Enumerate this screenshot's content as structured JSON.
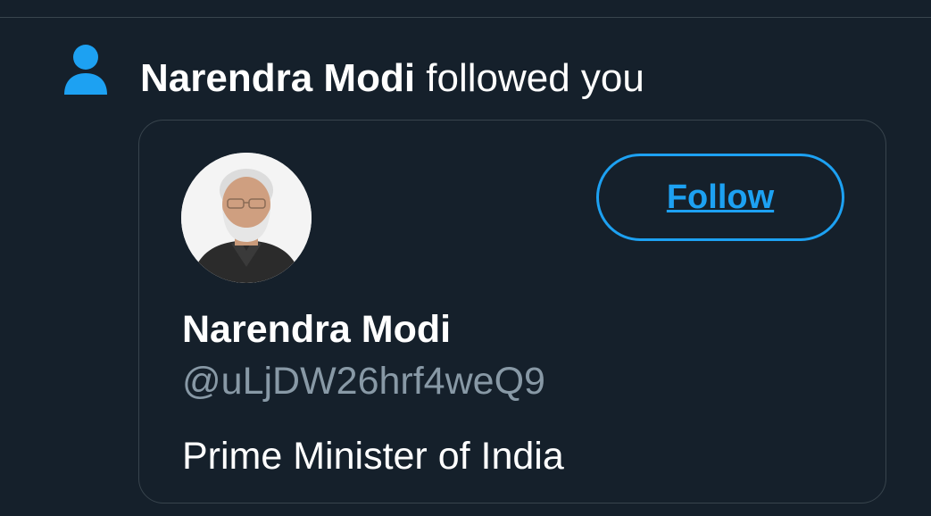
{
  "notification": {
    "icon": "person-icon",
    "actor_name": "Narendra Modi",
    "action_text": " followed you"
  },
  "user_card": {
    "avatar": "profile-photo",
    "display_name": "Narendra Modi",
    "handle": "@uLjDW26hrf4weQ9",
    "bio": "Prime Minister of India",
    "follow_label": "Follow"
  },
  "colors": {
    "background": "#15202b",
    "accent": "#1da1f2",
    "border": "#38444d",
    "secondary_text": "#8899a6"
  }
}
